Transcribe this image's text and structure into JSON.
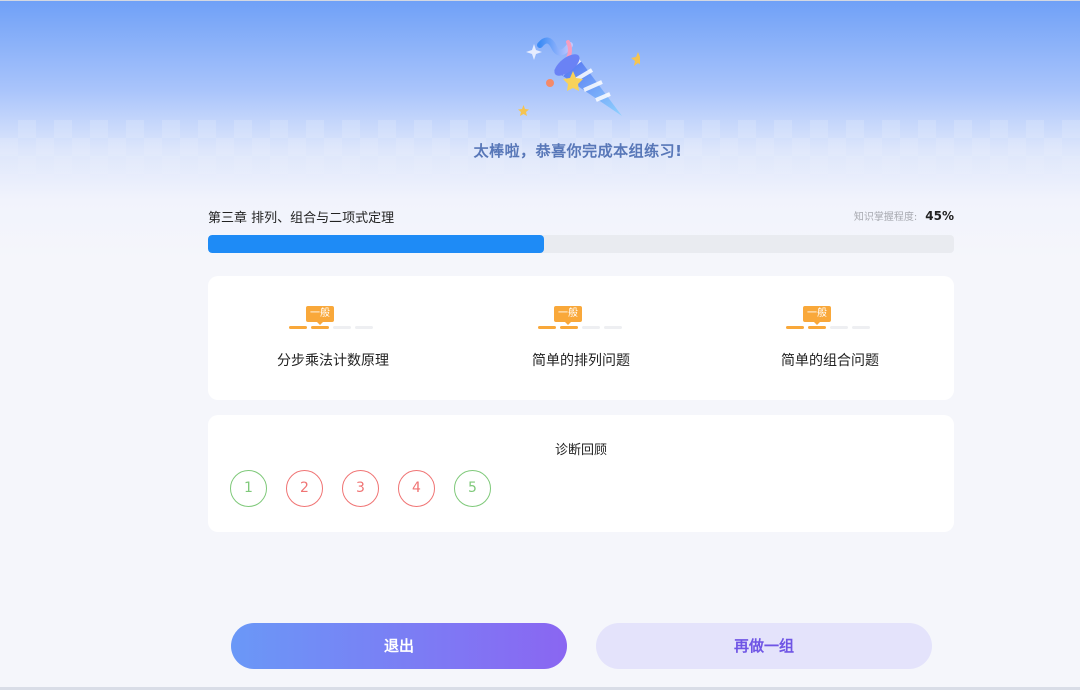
{
  "result": {
    "headline": "太棒啦，恭喜你完成本组练习!"
  },
  "chapter": {
    "title": "第三章 排列、组合与二项式定理",
    "mastery_label": "知识掌握程度:",
    "mastery_value": "45%",
    "mastery_fraction": 0.45
  },
  "knowledge_points": [
    {
      "name": "分步乘法计数原理",
      "level": "一般",
      "level_filled": 2,
      "level_total": 4
    },
    {
      "name": "简单的排列问题",
      "level": "一般",
      "level_filled": 2,
      "level_total": 4
    },
    {
      "name": "简单的组合问题",
      "level": "一般",
      "level_filled": 2,
      "level_total": 4
    }
  ],
  "review": {
    "title": "诊断回顾",
    "questions": [
      {
        "number": "1",
        "status": "correct"
      },
      {
        "number": "2",
        "status": "wrong"
      },
      {
        "number": "3",
        "status": "wrong"
      },
      {
        "number": "4",
        "status": "wrong"
      },
      {
        "number": "5",
        "status": "correct"
      }
    ]
  },
  "buttons": {
    "exit_label": "退出",
    "again_label": "再做一组"
  },
  "colors": {
    "primary_blue": "#1e8bf6",
    "level_orange": "#f9a83a",
    "correct_green": "#7fc97a",
    "wrong_red": "#f07474",
    "accent_purple": "#6f55e5"
  },
  "icons": [
    "party-popper-icon",
    "star-icon"
  ]
}
